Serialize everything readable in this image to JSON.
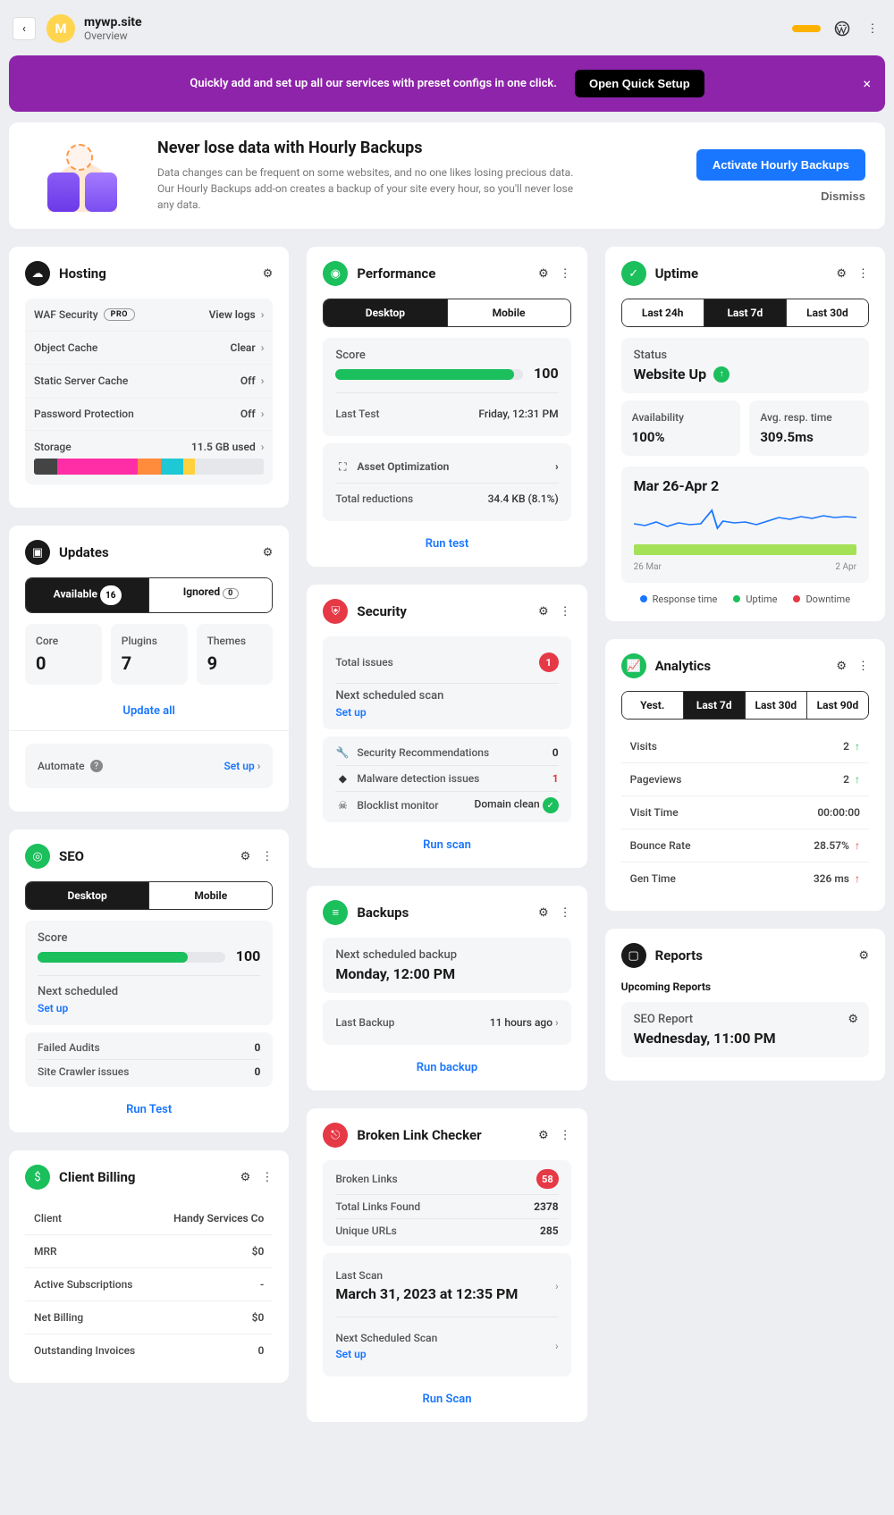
{
  "site": {
    "initial": "M",
    "name": "mywp.site",
    "sub": "Overview"
  },
  "banner": {
    "text": "Quickly add and set up all our services with preset configs in one click.",
    "btn": "Open Quick Setup"
  },
  "promo": {
    "title": "Never lose data with Hourly Backups",
    "desc": "Data changes can be frequent on some websites, and no one likes losing precious data. Our Hourly Backups add-on creates a backup of your site every hour, so you'll never lose any data.",
    "activate": "Activate Hourly Backups",
    "dismiss": "Dismiss"
  },
  "hosting": {
    "title": "Hosting",
    "rows": {
      "waf": "WAF Security",
      "waf_tag": "PRO",
      "waf_action": "View logs",
      "cache": "Object Cache",
      "cache_action": "Clear",
      "static": "Static Server Cache",
      "static_val": "Off",
      "pw": "Password Protection",
      "pw_val": "Off",
      "storage": "Storage",
      "storage_val": "11.5 GB used"
    }
  },
  "updates": {
    "title": "Updates",
    "available": "Available",
    "available_count": "16",
    "ignored": "Ignored",
    "ignored_count": "0",
    "core": "Core",
    "core_v": "0",
    "plugins": "Plugins",
    "plugins_v": "7",
    "themes": "Themes",
    "themes_v": "9",
    "update_all": "Update all",
    "automate": "Automate",
    "setup": "Set up"
  },
  "seo": {
    "title": "SEO",
    "desktop": "Desktop",
    "mobile": "Mobile",
    "score_label": "Score",
    "score": "100",
    "next": "Next scheduled",
    "setup": "Set up",
    "failed": "Failed Audits",
    "failed_v": "0",
    "crawler": "Site Crawler issues",
    "crawler_v": "0",
    "run": "Run Test"
  },
  "billing": {
    "title": "Client Billing",
    "client": "Client",
    "client_v": "Handy Services Co",
    "mrr": "MRR",
    "mrr_v": "$0",
    "subs": "Active Subscriptions",
    "subs_v": "-",
    "net": "Net Billing",
    "net_v": "$0",
    "out": "Outstanding Invoices",
    "out_v": "0"
  },
  "perf": {
    "title": "Performance",
    "desktop": "Desktop",
    "mobile": "Mobile",
    "score_label": "Score",
    "score": "100",
    "last_test": "Last Test",
    "last_test_v": "Friday, 12:31 PM",
    "asset": "Asset Optimization",
    "reductions": "Total reductions",
    "reductions_v": "34.4 KB (8.1%)",
    "run": "Run test"
  },
  "security": {
    "title": "Security",
    "total": "Total issues",
    "total_v": "1",
    "next": "Next scheduled scan",
    "setup": "Set up",
    "rec": "Security Recommendations",
    "rec_v": "0",
    "malware": "Malware detection issues",
    "malware_v": "1",
    "blocklist": "Blocklist monitor",
    "blocklist_v": "Domain clean",
    "run": "Run scan"
  },
  "backups": {
    "title": "Backups",
    "next_label": "Next scheduled backup",
    "next_v": "Monday, 12:00 PM",
    "last_label": "Last Backup",
    "last_v": "11 hours ago",
    "run": "Run backup"
  },
  "blc": {
    "title": "Broken Link Checker",
    "broken": "Broken Links",
    "broken_v": "58",
    "total": "Total Links Found",
    "total_v": "2378",
    "unique": "Unique URLs",
    "unique_v": "285",
    "last_label": "Last Scan",
    "last_v": "March 31, 2023 at 12:35 PM",
    "next_label": "Next Scheduled Scan",
    "setup": "Set up",
    "run": "Run Scan"
  },
  "uptime": {
    "title": "Uptime",
    "t24": "Last 24h",
    "t7": "Last 7d",
    "t30": "Last 30d",
    "status_label": "Status",
    "status_v": "Website Up",
    "avail_label": "Availability",
    "avail_v": "100%",
    "resp_label": "Avg. resp. time",
    "resp_v": "309.5ms",
    "range": "Mar 26-Apr 2",
    "d1": "26 Mar",
    "d2": "2 Apr",
    "leg_resp": "Response time",
    "leg_up": "Uptime",
    "leg_down": "Downtime"
  },
  "analytics": {
    "title": "Analytics",
    "yest": "Yest.",
    "t7": "Last 7d",
    "t30": "Last 30d",
    "t90": "Last 90d",
    "visits": "Visits",
    "visits_v": "2",
    "pv": "Pageviews",
    "pv_v": "2",
    "vt": "Visit Time",
    "vt_v": "00:00:00",
    "bounce": "Bounce Rate",
    "bounce_v": "28.57%",
    "gen": "Gen Time",
    "gen_v": "326 ms"
  },
  "reports": {
    "title": "Reports",
    "upcoming": "Upcoming Reports",
    "r_label": "SEO Report",
    "r_time": "Wednesday, 11:00 PM"
  }
}
